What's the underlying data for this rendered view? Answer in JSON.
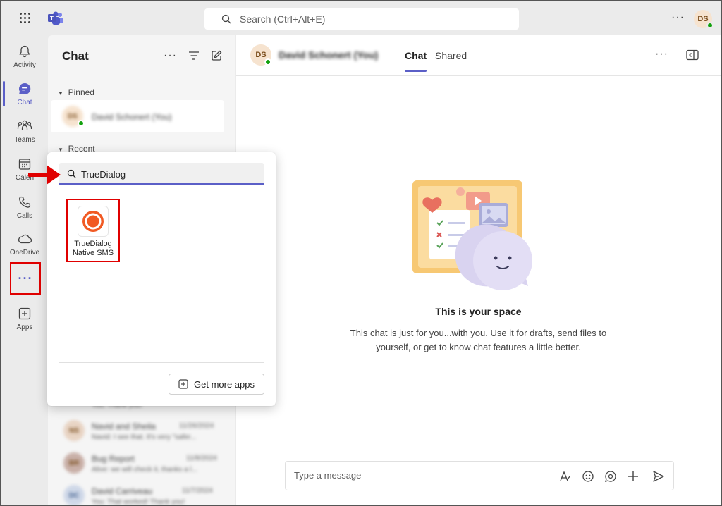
{
  "topbar": {
    "search_placeholder": "Search (Ctrl+Alt+E)",
    "user_initials": "DS"
  },
  "rail": {
    "items": [
      {
        "label": "Activity"
      },
      {
        "label": "Chat"
      },
      {
        "label": "Teams"
      },
      {
        "label": "Calen"
      },
      {
        "label": "Calls"
      },
      {
        "label": "OneDrive"
      },
      {
        "label": "Apps"
      }
    ]
  },
  "chat_list": {
    "title": "Chat",
    "pinned_label": "Pinned",
    "recent_label": "Recent",
    "pinned": [
      {
        "initials": "DS",
        "name": "David Schonert (You)"
      }
    ],
    "recent": [
      {
        "initials": "",
        "name": "",
        "preview": "You: Thank you!",
        "date": ""
      },
      {
        "initials": "NS",
        "name": "Navid and Sheila",
        "preview": "Navid: I see that. It's very \"safer...",
        "date": "11/26/2024"
      },
      {
        "initials": "BR",
        "name": "Bug Report",
        "preview": "Alive: we will check it, thanks a l...",
        "date": "11/8/2024"
      },
      {
        "initials": "DC",
        "name": "David Carriveau",
        "preview": "You: That worked! Thank you!",
        "date": "11/7/2024"
      }
    ]
  },
  "main": {
    "header_initials": "DS",
    "header_name": "David Schonert (You)",
    "tabs": [
      {
        "label": "Chat"
      },
      {
        "label": "Shared"
      }
    ],
    "empty_title": "This is your space",
    "empty_text": "This chat is just for you...with you. Use it for drafts, send files to yourself, or get to know chat features a little better.",
    "composer_placeholder": "Type a message"
  },
  "flyout": {
    "search_value": "TrueDialog",
    "app": {
      "label": "TrueDialog Native SMS"
    },
    "get_more_label": "Get more apps"
  },
  "colors": {
    "accent": "#5b5fc7",
    "annotation_red": "#e00000",
    "presence_green": "#13a10e"
  }
}
